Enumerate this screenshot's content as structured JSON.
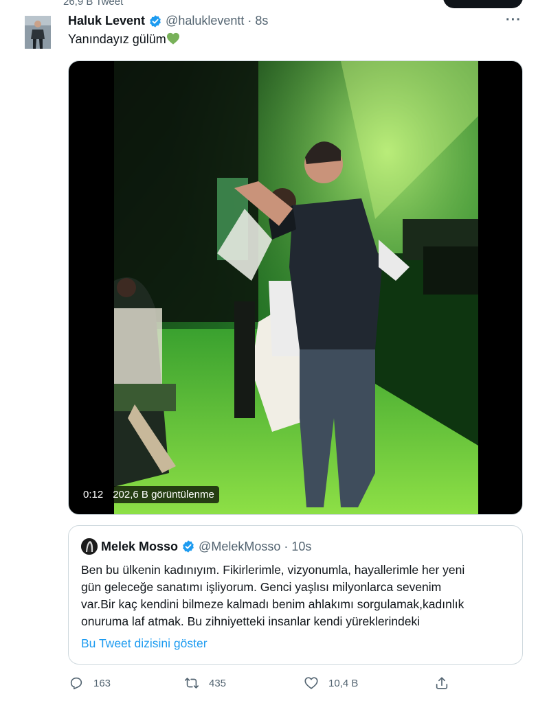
{
  "header": {
    "tweet_count": "26,9 B Tweet"
  },
  "tweet": {
    "author_name": "Haluk Levent",
    "author_handle": "@halukleventt",
    "separator": "·",
    "time": "8s",
    "text": "Yanındayız gülüm",
    "emoji": "green-heart-icon",
    "video": {
      "duration": "0:12",
      "views": "202,6 B görüntülenme"
    }
  },
  "quote": {
    "author_name": "Melek Mosso",
    "author_handle": "@MelekMosso",
    "separator": "·",
    "time": "10s",
    "lines": [
      "Ben bu ülkenin kadınıyım. Fikirlerimle, vizyonumla, hayallerimle her yeni",
      "gün geleceğe sanatımı işliyorum. Genci yaşlısı milyonlarca sevenim",
      "var.Bir kaç kendini bilmeze kalmadı benim ahlakımı sorgulamak,kadınlık",
      "onuruma laf atmak. Bu zihniyetteki insanlar kendi  yüreklerindeki"
    ],
    "show_thread": "Bu Tweet dizisini göster"
  },
  "actions": {
    "replies": "163",
    "retweets": "435",
    "likes": "10,4 B",
    "share": ""
  },
  "colors": {
    "accent": "#1d9bf0",
    "secondary_text": "#536471",
    "primary_text": "#0f1419",
    "border": "#cfd9de",
    "heart": "#78b159"
  }
}
